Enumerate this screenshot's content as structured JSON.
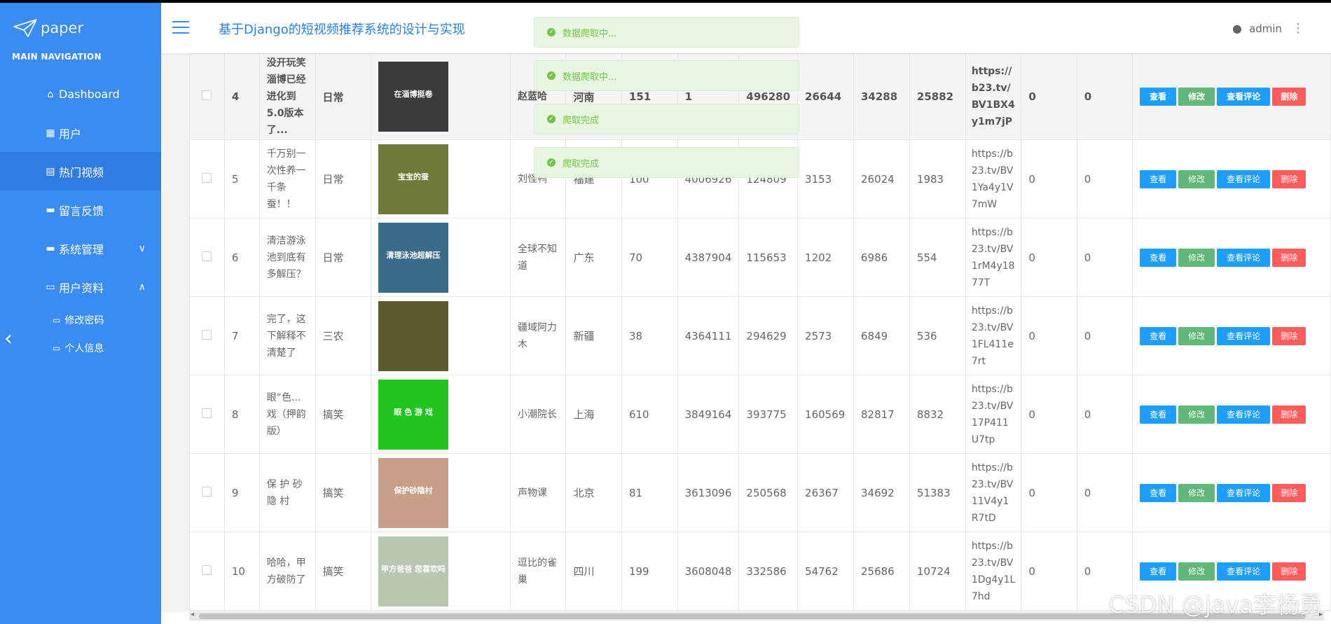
{
  "brand": {
    "name": "paper"
  },
  "sidebar": {
    "heading": "MAIN NAVIGATION",
    "items": [
      {
        "label": "Dashboard",
        "icon": "home-icon"
      },
      {
        "label": "用户",
        "icon": "grid-icon"
      },
      {
        "label": "热门视频",
        "icon": "clipboard-icon",
        "active": true
      },
      {
        "label": "留言反馈",
        "icon": "comment-icon"
      },
      {
        "label": "系统管理",
        "icon": "monitor-icon"
      },
      {
        "label": "用户资料",
        "icon": "card-icon"
      }
    ],
    "subitems": [
      {
        "label": "修改密码",
        "icon": "folder-icon"
      },
      {
        "label": "个人信息",
        "icon": "folder-icon"
      }
    ]
  },
  "header": {
    "title": "基于Django的短视频推荐系统的设计与实现",
    "user": "admin"
  },
  "toasts": [
    {
      "text": "数据爬取中..."
    },
    {
      "text": "数据爬取中..."
    },
    {
      "text": "爬取完成"
    },
    {
      "text": "爬取完成"
    }
  ],
  "buttons": {
    "view": "查看",
    "edit": "修改",
    "comments": "查看评论",
    "delete": "删除"
  },
  "rows": [
    {
      "id": "4",
      "title": "没开玩笑淄博已经进化到5.0版本了...",
      "category": "日常",
      "thumb_text": "在淄博挺卷",
      "author": "赵蓝哈",
      "province": "河南",
      "v1": "151",
      "v2": "1",
      "v3": "496280",
      "v4": "26644",
      "v5": "34288",
      "v6": "25882",
      "url": "https://b23.tv/BV1BX4y1m7jP",
      "z1": "0",
      "z2": "0"
    },
    {
      "id": "5",
      "title": "千万别一次性养一千条蚕！！",
      "category": "日常",
      "thumb_text": "宝宝的蚕",
      "author": "刘怪鸭",
      "province": "福建",
      "v1": "100",
      "v2": "4006926",
      "v3": "124809",
      "v4": "3153",
      "v5": "26024",
      "v6": "1983",
      "url": "https://b23.tv/BV1Ya4y1V7mW",
      "z1": "0",
      "z2": "0"
    },
    {
      "id": "6",
      "title": "清洁游泳池到底有多解压？",
      "category": "日常",
      "thumb_text": "清理泳池超解压",
      "author": "全球不知道",
      "province": "广东",
      "v1": "70",
      "v2": "4387904",
      "v3": "115653",
      "v4": "1202",
      "v5": "6986",
      "v6": "554",
      "url": "https://b23.tv/BV1rM4y1877T",
      "z1": "0",
      "z2": "0"
    },
    {
      "id": "7",
      "title": "完了，这下解释不清楚了",
      "category": "三农",
      "thumb_text": "",
      "author": "疆域阿力木",
      "province": "新疆",
      "v1": "38",
      "v2": "4364111",
      "v3": "294629",
      "v4": "2573",
      "v5": "6849",
      "v6": "536",
      "url": "https://b23.tv/BV1FL411e7rt",
      "z1": "0",
      "z2": "0"
    },
    {
      "id": "8",
      "title": "眼“色...戏（押韵版）",
      "category": "搞笑",
      "thumb_text": "眼 色 游 戏",
      "author": "小潮院长",
      "province": "上海",
      "v1": "610",
      "v2": "3849164",
      "v3": "393775",
      "v4": "160569",
      "v5": "82817",
      "v6": "8832",
      "url": "https://b23.tv/BV17P411U7tp",
      "z1": "0",
      "z2": "0"
    },
    {
      "id": "9",
      "title": "保 护 砂 隐 村",
      "category": "搞笑",
      "thumb_text": "保护砂隐村",
      "author": "声物课",
      "province": "北京",
      "v1": "81",
      "v2": "3613096",
      "v3": "250568",
      "v4": "26367",
      "v5": "34692",
      "v6": "51383",
      "url": "https://b23.tv/BV11V4y1R7tD",
      "z1": "0",
      "z2": "0"
    },
    {
      "id": "10",
      "title": "哈哈，甲方破防了",
      "category": "搞笑",
      "thumb_text": "甲方爸爸 您喜欢吗",
      "author": "逗比的雀巢",
      "province": "四川",
      "v1": "199",
      "v2": "3608048",
      "v3": "332586",
      "v4": "54762",
      "v5": "25686",
      "v6": "10724",
      "url": "https://b23.tv/BV1Dg4y1L7hd",
      "z1": "0",
      "z2": "0"
    }
  ],
  "thumb_colors": [
    "#3b3b3b",
    "#6d7a3a",
    "#3a6b8a",
    "#5a5a2a",
    "#22c422",
    "#c8a08a",
    "#b8c8b0"
  ],
  "watermark": "CSDN @java李杨勇"
}
